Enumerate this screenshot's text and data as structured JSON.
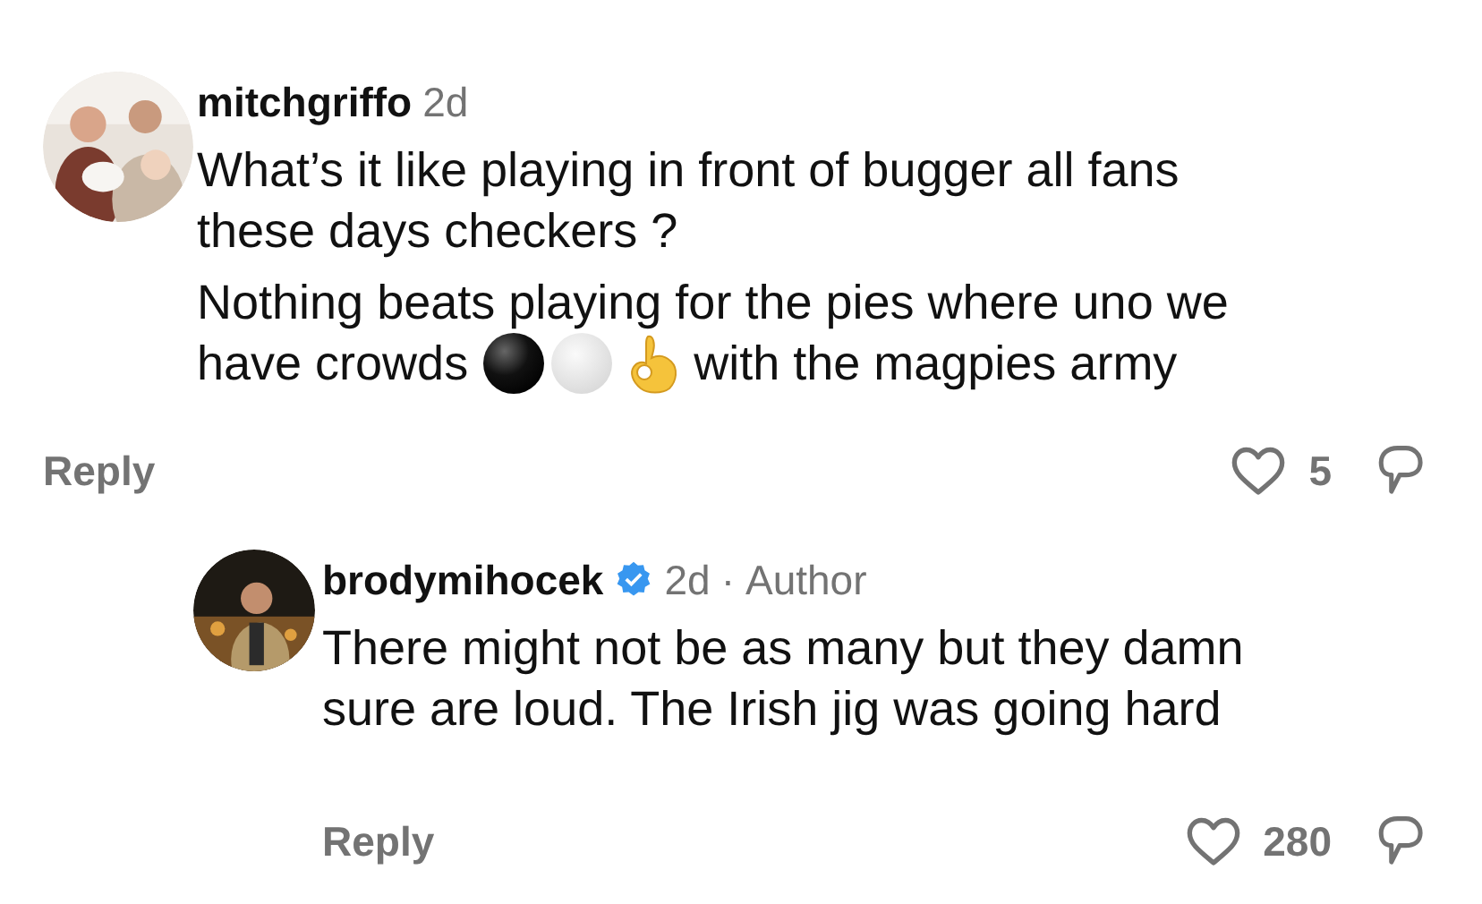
{
  "comments": [
    {
      "kind": "comment",
      "username": "mitchgriffo",
      "verified": false,
      "time": "2d",
      "paragraphs": [
        [
          [
            {
              "kind": "text",
              "text": "What’s it like playing in front of bugger all fans"
            }
          ],
          [
            {
              "kind": "text",
              "text": "these days checkers ?"
            }
          ]
        ],
        [
          [
            {
              "kind": "text",
              "text": "Nothing beats playing for the pies where uno we"
            }
          ],
          [
            {
              "kind": "text",
              "text": "have crowds"
            },
            {
              "kind": "black_ball"
            },
            {
              "kind": "white_ball"
            },
            {
              "kind": "ok_hand"
            },
            {
              "kind": "text",
              "text": "with the magpies army"
            }
          ]
        ]
      ],
      "reply": "Reply",
      "likes": "5"
    },
    {
      "kind": "reply",
      "username": "brodymihocek",
      "verified": true,
      "time": "2d",
      "separator": "·",
      "author_label": "Author",
      "paragraphs": [
        [
          [
            {
              "kind": "text",
              "text": "There might not be as many but they damn"
            }
          ],
          [
            {
              "kind": "text",
              "text": "sure are loud. The Irish jig was going hard"
            }
          ]
        ]
      ],
      "reply": "Reply",
      "likes": "280"
    }
  ]
}
